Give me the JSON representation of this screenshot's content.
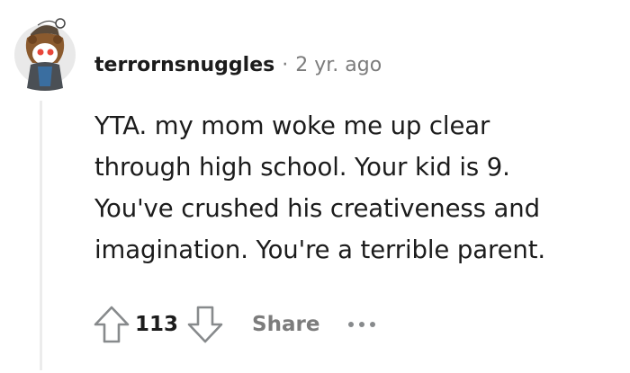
{
  "comment": {
    "author": "terrornsnuggles",
    "separator": "·",
    "age": "2 yr. ago",
    "body_lines": [
      "YTA. my mom woke me up clear",
      "through high school. Your kid is 9.",
      "You've crushed his creativeness and",
      "imagination. You're a terrible parent."
    ],
    "score": "113",
    "share_label": "Share",
    "colors": {
      "text": "#1c1c1c",
      "muted": "#7c7c7c",
      "thread_line": "#ececec"
    }
  }
}
